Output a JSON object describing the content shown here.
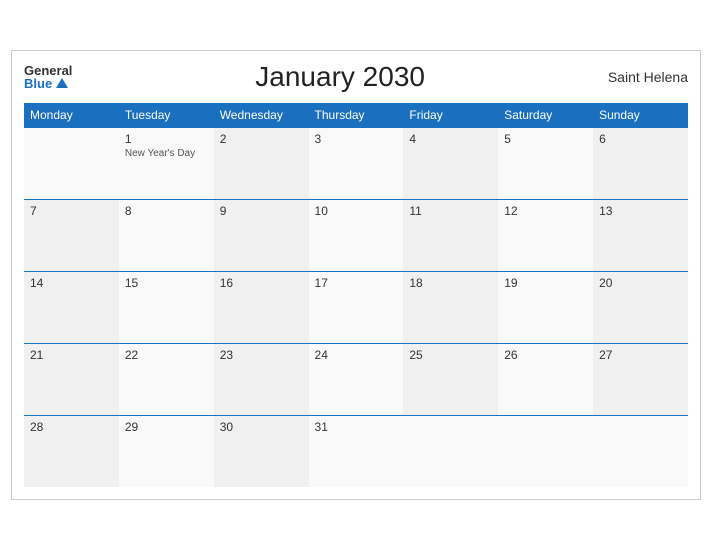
{
  "header": {
    "title": "January 2030",
    "region": "Saint Helena",
    "logo_general": "General",
    "logo_blue": "Blue"
  },
  "weekdays": [
    "Monday",
    "Tuesday",
    "Wednesday",
    "Thursday",
    "Friday",
    "Saturday",
    "Sunday"
  ],
  "weeks": [
    [
      {
        "day": "",
        "empty": true
      },
      {
        "day": "1",
        "holiday": "New Year's Day"
      },
      {
        "day": "2"
      },
      {
        "day": "3"
      },
      {
        "day": "4"
      },
      {
        "day": "5"
      },
      {
        "day": "6"
      }
    ],
    [
      {
        "day": "7"
      },
      {
        "day": "8"
      },
      {
        "day": "9"
      },
      {
        "day": "10"
      },
      {
        "day": "11"
      },
      {
        "day": "12"
      },
      {
        "day": "13"
      }
    ],
    [
      {
        "day": "14"
      },
      {
        "day": "15"
      },
      {
        "day": "16"
      },
      {
        "day": "17"
      },
      {
        "day": "18"
      },
      {
        "day": "19"
      },
      {
        "day": "20"
      }
    ],
    [
      {
        "day": "21"
      },
      {
        "day": "22"
      },
      {
        "day": "23"
      },
      {
        "day": "24"
      },
      {
        "day": "25"
      },
      {
        "day": "26"
      },
      {
        "day": "27"
      }
    ],
    [
      {
        "day": "28"
      },
      {
        "day": "29"
      },
      {
        "day": "30"
      },
      {
        "day": "31"
      },
      {
        "day": "",
        "empty": true
      },
      {
        "day": "",
        "empty": true
      },
      {
        "day": "",
        "empty": true
      }
    ]
  ]
}
